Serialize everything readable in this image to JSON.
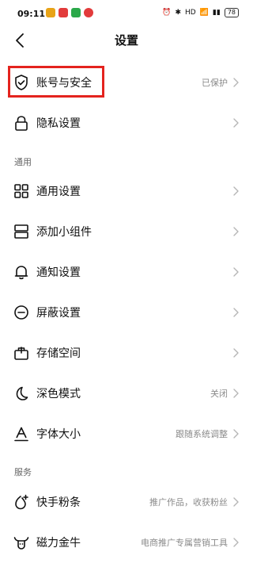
{
  "status_bar": {
    "time": "09:11",
    "signal_text": "HD",
    "battery": "78"
  },
  "header": {
    "title": "设置"
  },
  "account": {
    "label": "账号与安全",
    "value": "已保护"
  },
  "privacy": {
    "label": "隐私设置"
  },
  "general_section": {
    "title": "通用",
    "items": [
      {
        "label": "通用设置",
        "value": "",
        "icon": "grid-icon"
      },
      {
        "label": "添加小组件",
        "value": "",
        "icon": "widget-icon"
      },
      {
        "label": "通知设置",
        "value": "",
        "icon": "bell-icon"
      },
      {
        "label": "屏蔽设置",
        "value": "",
        "icon": "block-icon"
      },
      {
        "label": "存储空间",
        "value": "",
        "icon": "storage-icon"
      },
      {
        "label": "深色模式",
        "value": "关闭",
        "icon": "moon-icon"
      },
      {
        "label": "字体大小",
        "value": "跟随系统调整",
        "icon": "font-icon"
      }
    ]
  },
  "services_section": {
    "title": "服务",
    "items": [
      {
        "label": "快手粉条",
        "value": "推广作品，收获粉丝",
        "icon": "boost-icon"
      },
      {
        "label": "磁力金牛",
        "value": "电商推广专属营销工具",
        "icon": "bull-icon"
      }
    ]
  },
  "colors": {
    "highlight": "#e4231e",
    "value_text": "#8a8a8a"
  }
}
